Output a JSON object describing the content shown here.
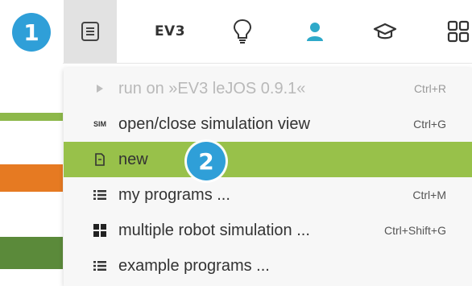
{
  "toolbar": {
    "items": [
      {
        "icon": "program-menu-icon",
        "active": true
      },
      {
        "icon": "ev3-icon",
        "label": "EV3"
      },
      {
        "icon": "lightbulb-icon"
      },
      {
        "icon": "user-icon"
      },
      {
        "icon": "graduation-cap-icon"
      },
      {
        "icon": "gallery-grid-icon"
      }
    ],
    "accent_color": "#2ea9c9"
  },
  "badges": {
    "step1": "1",
    "step2": "2",
    "color": "#2f9fd8"
  },
  "menu": {
    "highlight_color": "#98c14a",
    "items": [
      {
        "icon": "play-triangle-icon",
        "label": "run on »EV3 leJOS 0.9.1«",
        "shortcut": "Ctrl+R",
        "disabled": true
      },
      {
        "icon": "simulation-icon",
        "icon_text": "SIM",
        "label": "open/close simulation view",
        "shortcut": "Ctrl+G"
      },
      {
        "icon": "new-document-icon",
        "label": "new",
        "shortcut": "",
        "highlighted": true
      },
      {
        "icon": "list-icon",
        "label": "my programs ...",
        "shortcut": "Ctrl+M"
      },
      {
        "icon": "windows-icon",
        "label": "multiple robot simulation ...",
        "shortcut": "Ctrl+Shift+G"
      },
      {
        "icon": "list-icon",
        "label": "example programs ...",
        "shortcut": ""
      }
    ]
  },
  "canvas_strip": {
    "colors": [
      "#8db84a",
      "#e67a22",
      "#5b8a3a"
    ]
  }
}
